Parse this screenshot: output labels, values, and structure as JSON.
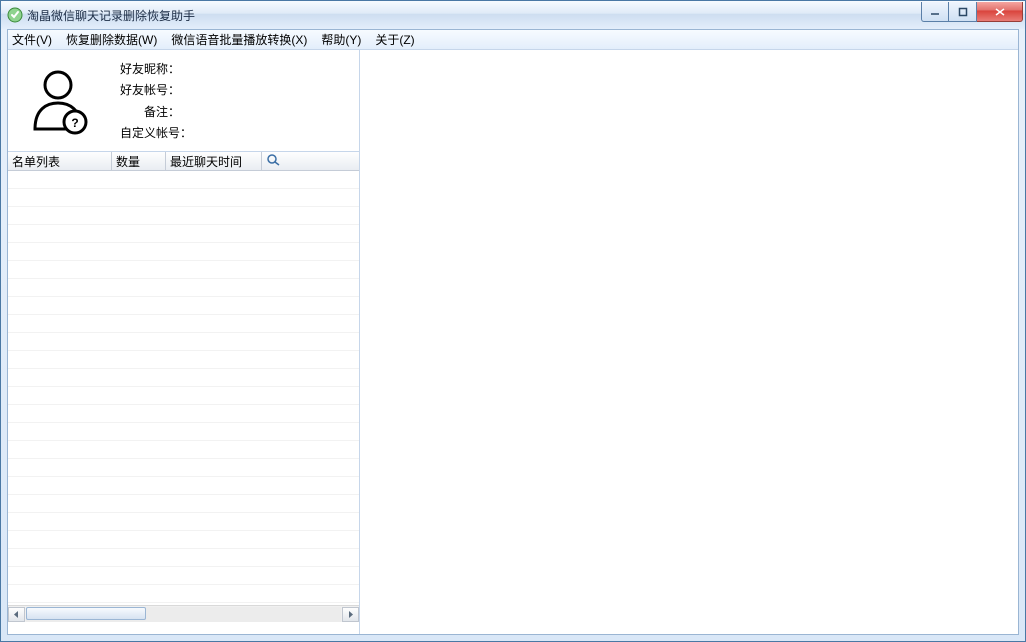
{
  "window": {
    "title": "淘晶微信聊天记录删除恢复助手"
  },
  "menu": {
    "file": "文件(V)",
    "recover": "恢复删除数据(W)",
    "voice": "微信语音批量播放转换(X)",
    "help": "帮助(Y)",
    "about": "关于(Z)"
  },
  "profile": {
    "nickname_label": "好友昵称：",
    "account_label": "好友帐号：",
    "remark_label": "备注：",
    "custom_label": "自定义帐号："
  },
  "columns": {
    "c0": "名单列表",
    "c1": "数量",
    "c2": "最近聊天时间"
  }
}
